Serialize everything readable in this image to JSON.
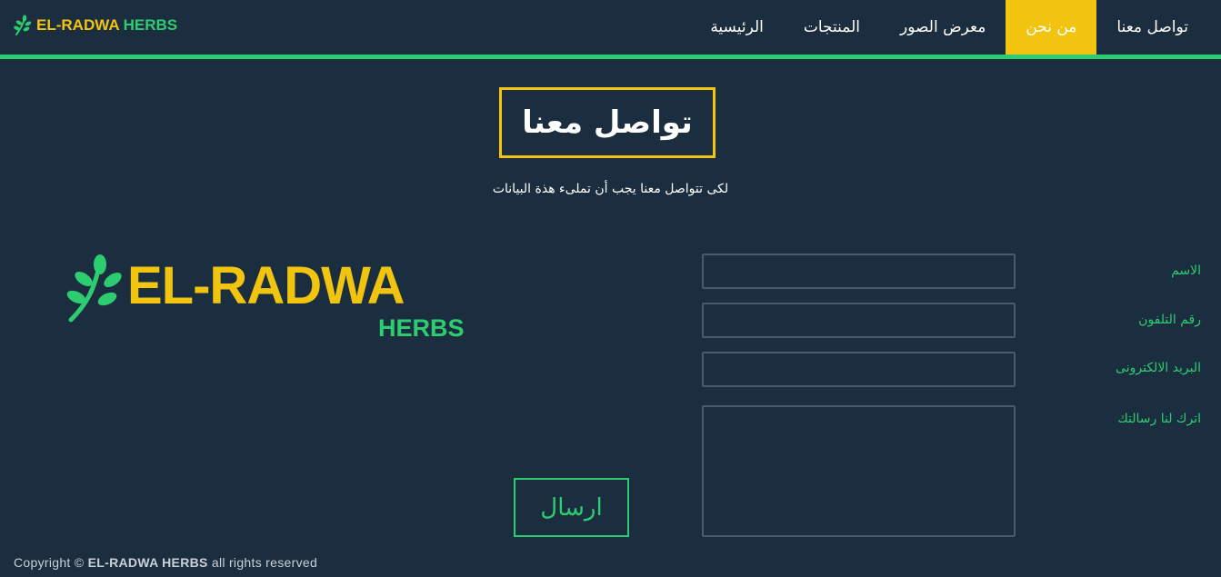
{
  "brand": {
    "part1": "EL-RADWA",
    "part2": "HERBS",
    "leaf_icon": "leaf-icon",
    "colors": {
      "yellow": "#f1c40f",
      "green": "#2ecc71",
      "background": "#1b2e3f"
    }
  },
  "nav": {
    "items": [
      {
        "label": "تواصل معنا",
        "active": false
      },
      {
        "label": "من نحن",
        "active": true
      },
      {
        "label": "معرض الصور",
        "active": false
      },
      {
        "label": "المنتجات",
        "active": false
      },
      {
        "label": "الرئيسية",
        "active": false
      }
    ]
  },
  "page": {
    "title": "تواصل معنا",
    "subtitle": "لكى تتواصل معنا يجب أن تملىء هذة البيانات"
  },
  "logo": {
    "name": "EL-RADWA",
    "sub": "HERBS"
  },
  "form": {
    "name_label": "الاسم",
    "phone_label": "رقم التلفون",
    "email_label": "البريد الالكترونى",
    "message_label": "اترك لنا رسالتك",
    "name_value": "",
    "phone_value": "",
    "email_value": "",
    "message_value": "",
    "submit_label": "ارسال"
  },
  "footer": {
    "prefix": "Copyright ©",
    "brand": "EL-RADWA HERBS",
    "suffix": "all rights reserved"
  }
}
